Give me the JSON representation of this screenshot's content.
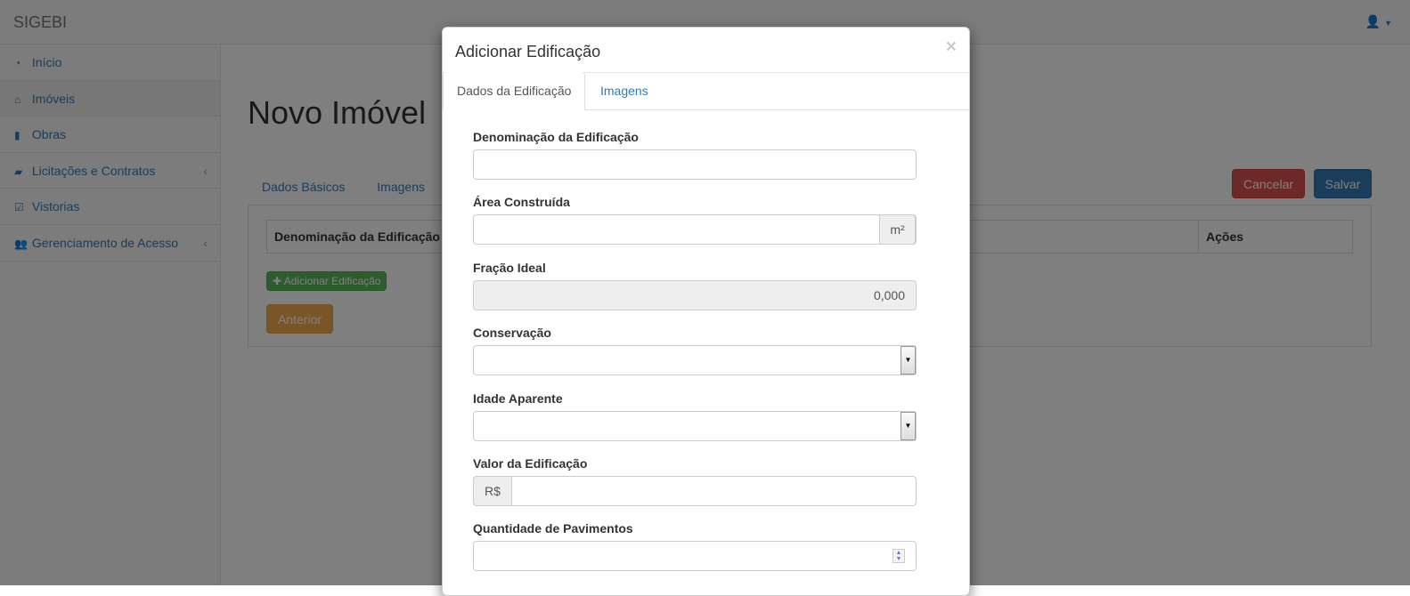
{
  "app": {
    "brand": "SIGEBI",
    "user_icon": "user-icon"
  },
  "sidebar": {
    "items": [
      {
        "label": "Início",
        "icon": "dashboard-icon"
      },
      {
        "label": "Imóveis",
        "icon": "home-icon"
      },
      {
        "label": "Obras",
        "icon": "building-icon"
      },
      {
        "label": "Licitações e Contratos",
        "icon": "book-icon"
      },
      {
        "label": "Vistorias",
        "icon": "check-square-icon"
      },
      {
        "label": "Gerenciamento de Acesso",
        "icon": "users-icon"
      }
    ]
  },
  "main": {
    "title": "Novo Imóvel",
    "tabs": [
      "Dados Básicos",
      "Imagens"
    ],
    "cancel_label": "Cancelar",
    "save_label": "Salvar",
    "table": {
      "col_name": "Denominação da Edificação",
      "col_actions": "Ações"
    },
    "add_label": "Adicionar Edificação",
    "prev_label": "Anterior"
  },
  "modal": {
    "title": "Adicionar Edificação",
    "close": "×",
    "tabs": [
      "Dados da Edificação",
      "Imagens"
    ],
    "fields": {
      "denominacao": {
        "label": "Denominação da Edificação",
        "value": ""
      },
      "area": {
        "label": "Área Construída",
        "value": "",
        "unit": "m²"
      },
      "fracao": {
        "label": "Fração Ideal",
        "value": "0,000"
      },
      "conservacao": {
        "label": "Conservação",
        "value": ""
      },
      "idade": {
        "label": "Idade Aparente",
        "value": ""
      },
      "valor": {
        "label": "Valor da Edificação",
        "prefix": "R$",
        "value": ""
      },
      "pavimentos": {
        "label": "Quantidade de Pavimentos",
        "value": ""
      }
    }
  }
}
